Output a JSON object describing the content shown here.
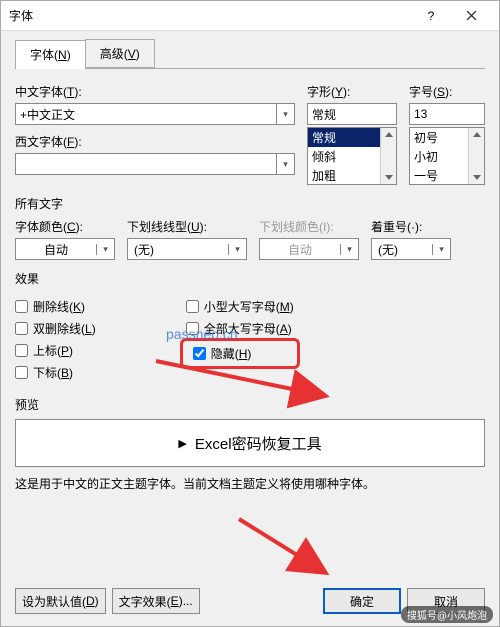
{
  "window": {
    "title": "字体"
  },
  "tabs": {
    "font": "字体",
    "font_key": "N",
    "adv": "高级",
    "adv_key": "V"
  },
  "fields": {
    "cn_font_label": "中文字体(",
    "cn_font_key": "T",
    "cn_font_value": "+中文正文",
    "west_font_label": "西文字体(",
    "west_font_key": "F",
    "style_label": "字形(",
    "style_key": "Y",
    "style_value": "常规",
    "size_label": "字号(",
    "size_key": "S",
    "size_value": "13"
  },
  "style_list": [
    "常规",
    "倾斜",
    "加粗"
  ],
  "size_list": [
    "初号",
    "小初",
    "一号"
  ],
  "section_allchar": "所有文字",
  "color": {
    "label": "字体颜色(",
    "key": "C",
    "value": "自动"
  },
  "underline": {
    "label": "下划线线型(",
    "key": "U",
    "value": "(无)"
  },
  "ul_color": {
    "label": "下划线颜色(I):",
    "value": "自动"
  },
  "emphasis": {
    "label": "着重号(·):",
    "value": "(无)"
  },
  "section_effects": "效果",
  "fx": {
    "strike": "删除线(",
    "strike_key": "K",
    "dblstrike": "双删除线(",
    "dblstrike_key": "L",
    "sup": "上标(",
    "sup_key": "P",
    "sub": "下标(",
    "sub_key": "B",
    "smallcaps": "小型大写字母(",
    "smallcaps_key": "M",
    "allcaps": "全部大写字母(",
    "allcaps_key": "A",
    "hidden": "隐藏(",
    "hidden_key": "H"
  },
  "watermark": "passneo.cn",
  "preview_label": "预览",
  "preview_text": "Excel密码恢复工具",
  "desc": "这是用于中文的正文主题字体。当前文档主题定义将使用哪种字体。",
  "buttons": {
    "default": "设为默认值(",
    "default_key": "D",
    "texteffects": "文字效果(",
    "texteffects_key": "E",
    "ok": "确定",
    "cancel": "取消"
  },
  "signature": "搜狐号@小风炮泡",
  "paren": ")",
  "colon": "):"
}
